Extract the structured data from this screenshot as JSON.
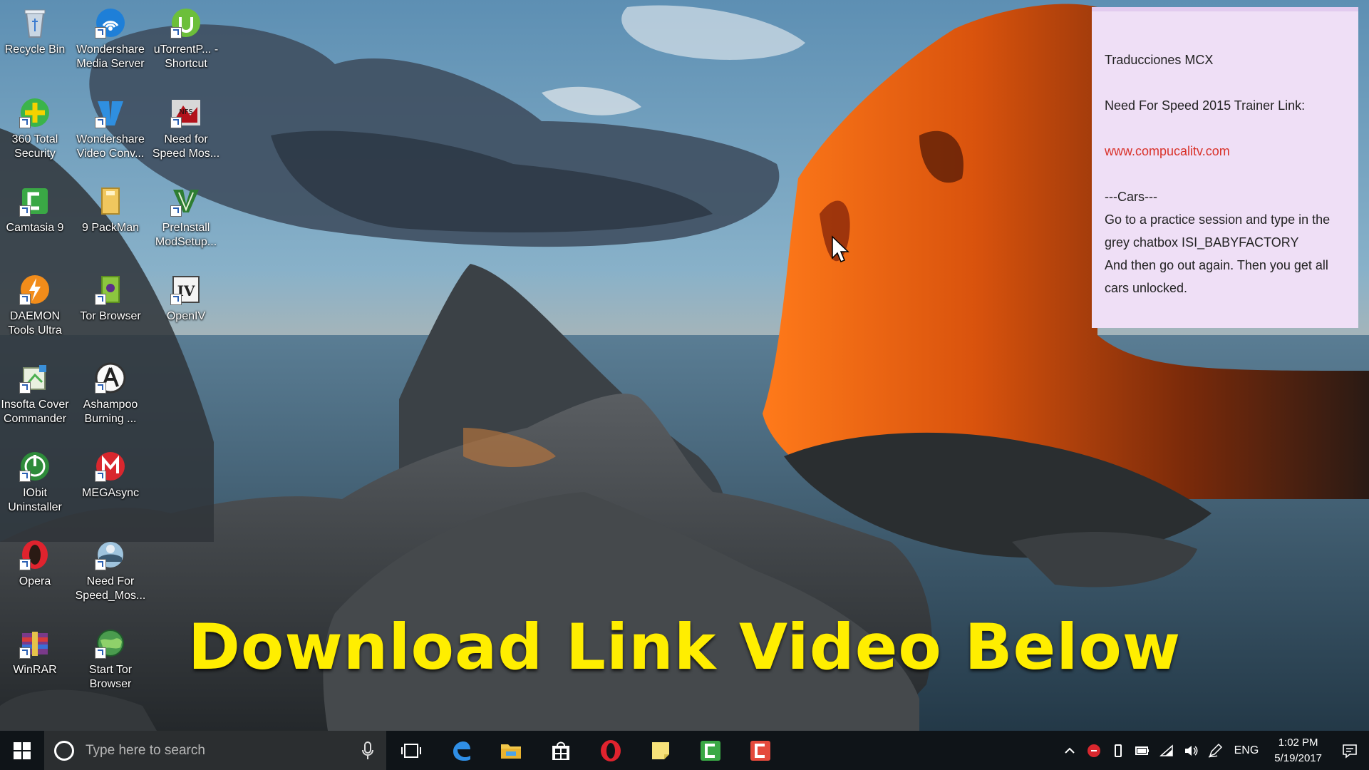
{
  "desktop": {
    "icons": [
      {
        "label": "Recycle Bin",
        "icon": "recycle-bin-icon"
      },
      {
        "label": "Wondershare Media Server",
        "icon": "media-server-icon"
      },
      {
        "label": "uTorrentP... - Shortcut",
        "icon": "utorrent-icon"
      },
      {
        "label": "360 Total Security",
        "icon": "security-shield-icon"
      },
      {
        "label": "Wondershare Video Conv...",
        "icon": "video-converter-icon"
      },
      {
        "label": "Need for Speed Mos...",
        "icon": "nfs-game-icon"
      },
      {
        "label": "Camtasia 9",
        "icon": "camtasia-icon"
      },
      {
        "label": "9 PackMan",
        "icon": "package-icon"
      },
      {
        "label": "PreInstall ModSetup...",
        "icon": "setup-v-icon"
      },
      {
        "label": "DAEMON Tools Ultra",
        "icon": "daemon-tools-icon"
      },
      {
        "label": "Tor Browser",
        "icon": "tor-browser-icon"
      },
      {
        "label": "OpenIV",
        "icon": "openiv-icon"
      },
      {
        "label": "Insofta Cover Commander",
        "icon": "cover-commander-icon"
      },
      {
        "label": "Ashampoo Burning ...",
        "icon": "ashampoo-icon"
      },
      {
        "label": "IObit Uninstaller",
        "icon": "uninstaller-icon"
      },
      {
        "label": "MEGAsync",
        "icon": "megasync-icon"
      },
      {
        "label": "Opera",
        "icon": "opera-icon"
      },
      {
        "label": "Need For Speed_Mos...",
        "icon": "nfs-globe-icon"
      },
      {
        "label": "WinRAR",
        "icon": "winrar-icon"
      },
      {
        "label": "Start Tor Browser",
        "icon": "tor-globe-icon"
      }
    ]
  },
  "sticky_note": {
    "title": "Traducciones MCX",
    "subtitle": "Need For Speed 2015 Trainer Link:",
    "link": "www.compucalitv.com",
    "section": "---Cars---",
    "line1": "Go to a practice session and type in the",
    "line2": "grey chatbox ISI_BABYFACTORY",
    "line3": "And then go out again. Then you get all",
    "line4": "cars unlocked.",
    "background_color": "#efdff6",
    "link_color": "#d9322a"
  },
  "overlay": {
    "caption": "Download Link Video Below",
    "caption_color": "#ffee00"
  },
  "taskbar": {
    "search_placeholder": "Type here to search",
    "pinned": [
      "task-view-icon",
      "edge-icon",
      "file-explorer-icon",
      "store-icon",
      "opera-icon",
      "sticky-notes-icon",
      "camtasia-icon",
      "camtasia-recorder-icon"
    ],
    "tray": {
      "language": "ENG",
      "time": "1:02 PM",
      "date": "5/19/2017"
    }
  }
}
